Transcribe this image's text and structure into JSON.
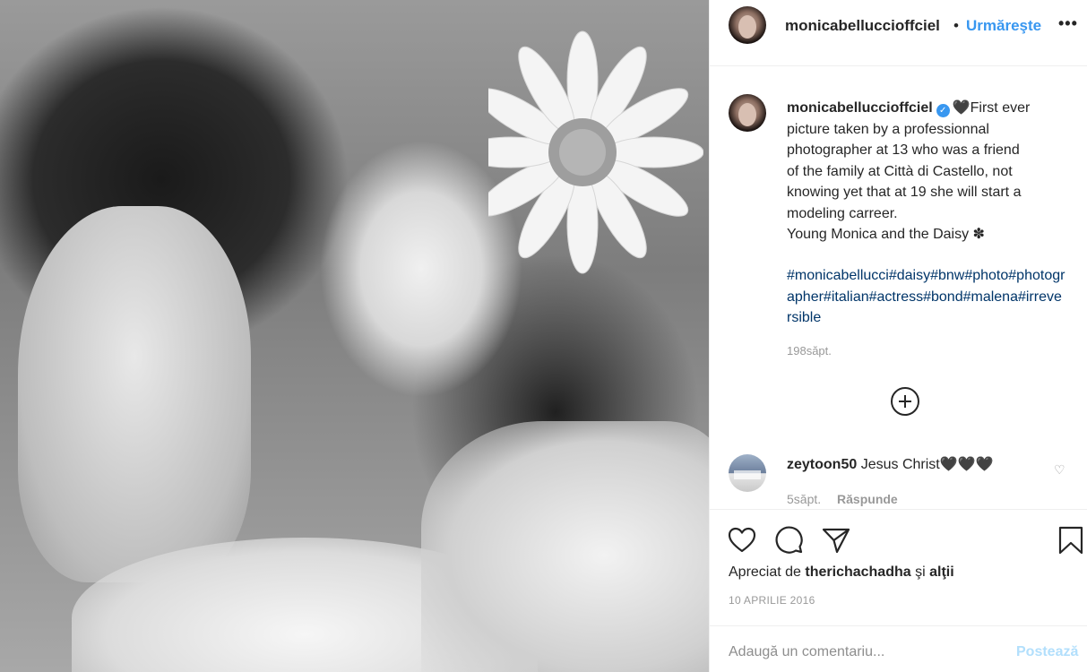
{
  "post": {
    "username": "monicabelluccioffciel",
    "follow_dot": "•",
    "follow_label": "Urmăreşte",
    "more_label": "•••"
  },
  "caption": {
    "username": "monicabelluccioffciel",
    "verified_badge": "✓",
    "heart": "🖤",
    "text_lines": [
      "First ever",
      "picture taken by a professionnal",
      "photographer at 13 who was a friend",
      "of the family at Città di Castello, not",
      "knowing yet that at 19 she will start a",
      "modeling carreer.",
      "Young Monica and the Daisy ✽"
    ],
    "hashtags": "#monicabellucci#daisy#bnw#photo#photographer#italian#actress#bond#malena#irreversible",
    "time": "198săpt."
  },
  "comment": {
    "username": "zeytoon50",
    "text": "Jesus Christ🖤🖤🖤",
    "time": "5săpt.",
    "reply_label": "Răspunde",
    "like_icon": "♡"
  },
  "likes": {
    "prefix": "Apreciat de",
    "liker": "therichachadha",
    "connector": "şi",
    "others": "alţii"
  },
  "date": "10 APRILIE 2016",
  "add_comment": {
    "placeholder": "Adaugă un comentariu...",
    "post_label": "Postează"
  },
  "icons": {
    "like": "heart-outline-icon",
    "comment": "speech-bubble-icon",
    "share": "paper-plane-icon",
    "save": "bookmark-icon",
    "more": "ellipsis-icon",
    "load_more": "plus-circle-icon"
  },
  "colors": {
    "accent": "#3897f0",
    "hashtag": "#003569",
    "muted": "#999999",
    "post_disabled": "#b2dffc"
  }
}
